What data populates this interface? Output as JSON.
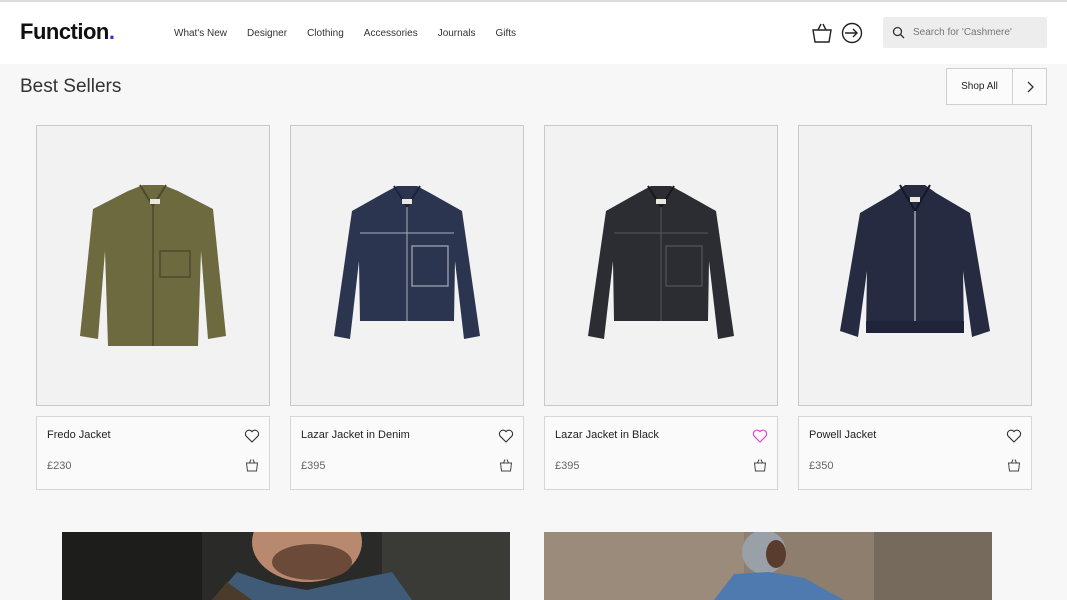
{
  "brand": {
    "name": "Function",
    "dot": "."
  },
  "nav": {
    "items": [
      "What's New",
      "Designer",
      "Clothing",
      "Accessories",
      "Journals",
      "Gifts"
    ]
  },
  "search": {
    "placeholder": "Search for 'Cashmere'"
  },
  "section": {
    "title": "Best Sellers",
    "shop_all": "Shop All"
  },
  "products": [
    {
      "name": "Fredo Jacket",
      "price": "£230",
      "color": "#6d6a3f",
      "favorited": false
    },
    {
      "name": "Lazar Jacket in Denim",
      "price": "£395",
      "color": "#2b3550",
      "favorited": false
    },
    {
      "name": "Lazar Jacket in Black",
      "price": "£395",
      "color": "#2c2d33",
      "favorited": true
    },
    {
      "name": "Powell Jacket",
      "price": "£350",
      "color": "#262b42",
      "favorited": false
    }
  ],
  "colors": {
    "accent": "#3a2fd6",
    "favorite": "#d94fd0"
  },
  "icons": [
    "bag-icon",
    "login-icon",
    "search-icon",
    "chevron-right-icon",
    "heart-icon",
    "cart-icon"
  ]
}
